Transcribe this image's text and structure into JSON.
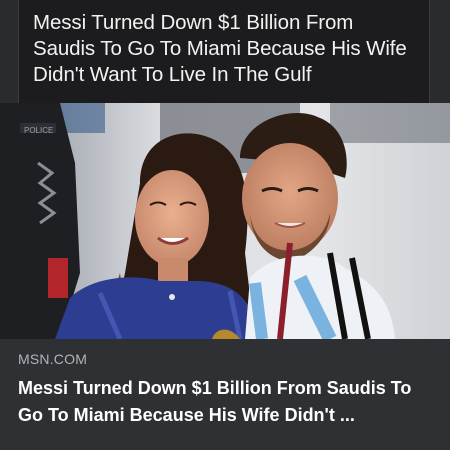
{
  "post": {
    "caption": "Messi Turned Down $1 Billion From Saudis To Go To Miami Because His Wife Didn't Want To Live In The Gulf"
  },
  "link_preview": {
    "source": "MSN.COM",
    "title": "Messi Turned Down $1 Billion From Saudis To Go To Miami Because His Wife Didn't ..."
  },
  "colors": {
    "background": "#2a2b2d",
    "caption_bg": "#1c1c1e",
    "card_bg": "#2f3033",
    "text_primary": "#ffffff",
    "text_secondary": "#b0b3b8"
  }
}
